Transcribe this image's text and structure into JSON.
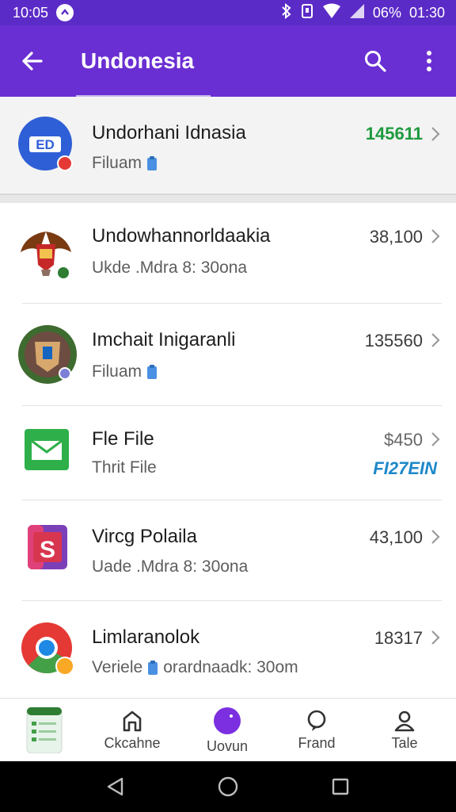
{
  "status_bar": {
    "time": "10:05",
    "battery": "06%",
    "clock": "01:30"
  },
  "app_bar": {
    "title": "Undonesia",
    "icons": [
      "back-arrow-icon",
      "search-icon",
      "more-vert-icon"
    ]
  },
  "top_item": {
    "avatar_text": "ED",
    "title": "Undorhani Idnasia",
    "subtitle": "Filuam",
    "amount": "145611"
  },
  "items": [
    {
      "title": "Undowhannorldaakia",
      "subtitle": "Ukde .Mdra 8: 30ona",
      "amount": "38,100",
      "avatar": "eagle-emblem-icon"
    },
    {
      "title": "Imchait Inigaranli",
      "subtitle": "Filuam",
      "amount": "135560",
      "avatar": "crest-emblem-icon"
    },
    {
      "title": "Fle File",
      "subtitle": "Thrit File",
      "amount": "$450",
      "extra": "FI27EIN",
      "avatar": "mail-icon"
    },
    {
      "title": "Vircg Polaila",
      "subtitle": "Uade .Mdra 8: 30ona",
      "amount": "43,100",
      "avatar": "s-app-icon"
    },
    {
      "title": "Limlaranolok",
      "subtitle_prefix": "Veriele",
      "subtitle": "orardnaadk: 30om",
      "amount": "18317",
      "avatar": "chrome-icon"
    }
  ],
  "bottom_nav": [
    {
      "label": "",
      "icon": "wallet-card-icon"
    },
    {
      "label": "Ckcahne",
      "icon": "home-icon"
    },
    {
      "label": "Uovun",
      "icon": "circle-purple-icon"
    },
    {
      "label": "Frand",
      "icon": "chat-icon"
    },
    {
      "label": "Tale",
      "icon": "person-icon"
    }
  ],
  "colors": {
    "primary": "#6a2fd3",
    "status": "#5b2bc7",
    "amount_green": "#1e9a3e",
    "accent_blue": "#1e88c9"
  }
}
